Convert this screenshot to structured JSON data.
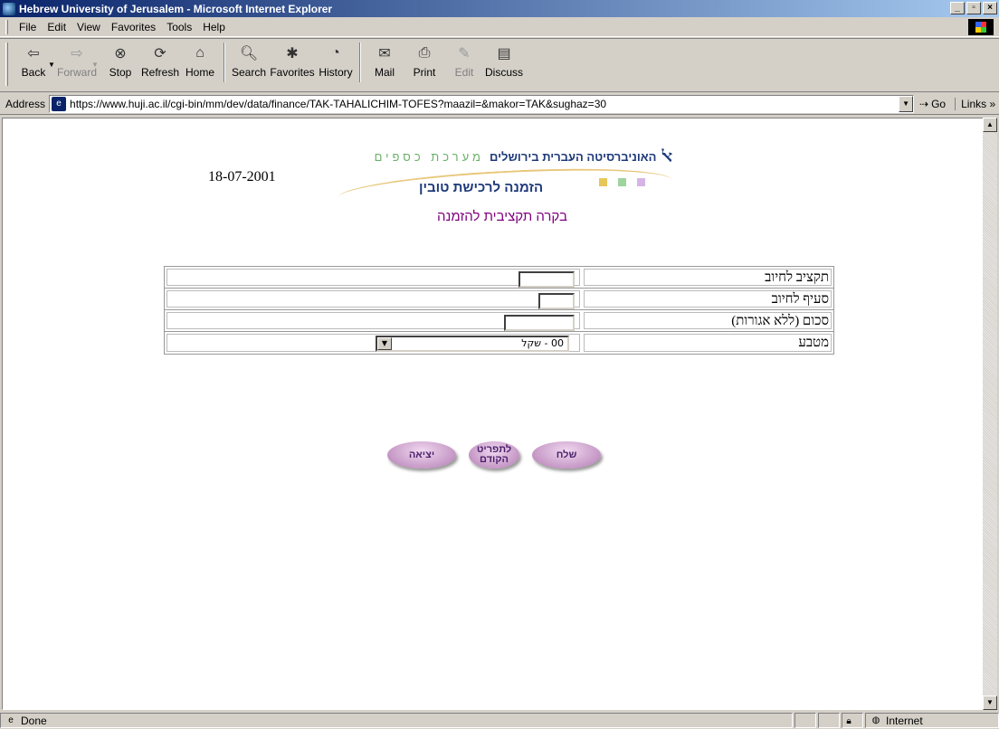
{
  "window": {
    "title": "Hebrew University of Jerusalem - Microsoft Internet Explorer",
    "controls": [
      "_",
      "▫",
      "×"
    ]
  },
  "menu": {
    "items": [
      {
        "label": "File"
      },
      {
        "label": "Edit"
      },
      {
        "label": "View"
      },
      {
        "label": "Favorites"
      },
      {
        "label": "Tools"
      },
      {
        "label": "Help"
      }
    ]
  },
  "toolbar": {
    "back": "Back",
    "forward": "Forward",
    "stop": "Stop",
    "refresh": "Refresh",
    "home": "Home",
    "search": "Search",
    "favorites": "Favorites",
    "history": "History",
    "mail": "Mail",
    "print": "Print",
    "edit": "Edit",
    "discuss": "Discuss"
  },
  "address": {
    "label": "Address",
    "url": "https://www.huji.ac.il/cgi-bin/mm/dev/data/finance/TAK-TAHALICHIM-TOFES?maazil=&makor=TAK&sughaz=30",
    "go": "Go",
    "links": "Links »"
  },
  "page": {
    "university": "האוניברסיטה העברית בירושלים",
    "finance_system": "מערכת כספים",
    "order_title": "הזמנה לרכישת טובין",
    "date": "18-07-2001",
    "subtitle": "בקרה תקציבית להזמנה",
    "colors": {
      "square1": "#e8c75a",
      "square2": "#9fd39f",
      "square3": "#d7b4e6",
      "purple": "#800080",
      "navy": "#1e3a7a"
    }
  },
  "form": {
    "rows": [
      {
        "label": "תקציב לחיוב",
        "value": ""
      },
      {
        "label": "סעיף לחיוב",
        "value": ""
      },
      {
        "label": "סכום  (ללא אגורות)",
        "value": ""
      },
      {
        "label": "מטבע",
        "value": "00 - שקל"
      }
    ]
  },
  "actions": {
    "send": "שלח",
    "previous": "לתפריט הקודם",
    "exit": "יציאה"
  },
  "status": {
    "text": "Done",
    "zone": "Internet"
  }
}
